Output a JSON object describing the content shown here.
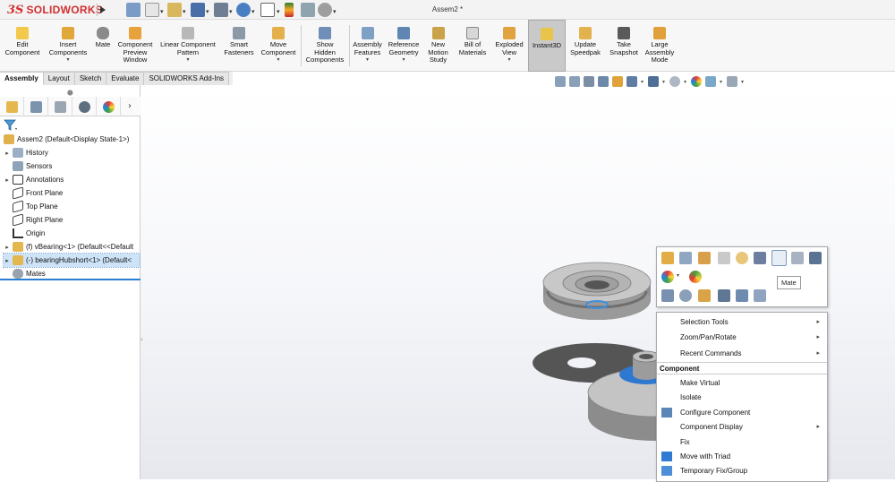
{
  "app": {
    "brand_prefix": "3S",
    "brand": "SOLIDWORKS",
    "document_title": "Assem2 *"
  },
  "colors": {
    "brand_red": "#d32f2f",
    "selection_blue": "#cde3f7",
    "accent_blue": "#2b7fd1"
  },
  "quick_access": [
    {
      "icon": "home-icon"
    },
    {
      "icon": "new-icon"
    },
    {
      "icon": "open-icon"
    },
    {
      "icon": "save-icon"
    },
    {
      "icon": "print-icon"
    },
    {
      "icon": "undo-icon"
    },
    {
      "icon": "select-icon"
    },
    {
      "icon": "rebuild-icon"
    },
    {
      "icon": "file-properties-icon"
    },
    {
      "icon": "options-icon"
    }
  ],
  "ribbon": [
    {
      "label": "Edit\nComponent",
      "dd": ""
    },
    {
      "label": "Insert\nComponents",
      "dd": "▾"
    },
    {
      "label": "Mate",
      "dd": ""
    },
    {
      "label": "Component\nPreview\nWindow",
      "dd": ""
    },
    {
      "label": "Linear Component\nPattern",
      "dd": "▾"
    },
    {
      "label": "Smart\nFasteners",
      "dd": ""
    },
    {
      "label": "Move\nComponent",
      "dd": "▾"
    },
    {
      "label": "Show\nHidden\nComponents",
      "dd": ""
    },
    {
      "label": "Assembly\nFeatures",
      "dd": "▾"
    },
    {
      "label": "Reference\nGeometry",
      "dd": "▾"
    },
    {
      "label": "New\nMotion\nStudy",
      "dd": ""
    },
    {
      "label": "Bill of\nMaterials",
      "dd": ""
    },
    {
      "label": "Exploded\nView",
      "dd": "▾"
    },
    {
      "label": "Instant3D",
      "dd": ""
    },
    {
      "label": "Update\nSpeedpak",
      "dd": ""
    },
    {
      "label": "Take\nSnapshot",
      "dd": ""
    },
    {
      "label": "Large\nAssembly\nMode",
      "dd": ""
    }
  ],
  "tabs": [
    "Assembly",
    "Layout",
    "Sketch",
    "Evaluate",
    "SOLIDWORKS Add-Ins"
  ],
  "feature_tree": [
    {
      "label": "Assem2  (Default<Display State-1>)",
      "exp": ""
    },
    {
      "label": "History",
      "exp": "▸"
    },
    {
      "label": "Sensors",
      "exp": ""
    },
    {
      "label": "Annotations",
      "exp": "▸"
    },
    {
      "label": "Front Plane",
      "exp": ""
    },
    {
      "label": "Top Plane",
      "exp": ""
    },
    {
      "label": "Right Plane",
      "exp": ""
    },
    {
      "label": "Origin",
      "exp": ""
    },
    {
      "label": "(f) vBearing<1> (Default<<Default",
      "exp": "▸"
    },
    {
      "label": "(-) bearingHubshort<1> (Default<",
      "exp": "▸"
    },
    {
      "label": "Mates",
      "exp": ""
    }
  ],
  "context_toolbar": {
    "tooltip": "Mate"
  },
  "context_menu": {
    "items_top": [
      {
        "label": "Selection Tools",
        "arrow": "▸"
      },
      {
        "label": "Zoom/Pan/Rotate",
        "arrow": "▸"
      },
      {
        "label": "Recent Commands",
        "arrow": "▸"
      }
    ],
    "section": "Component",
    "items": [
      {
        "label": "Make Virtual",
        "arrow": ""
      },
      {
        "label": "Isolate",
        "arrow": ""
      },
      {
        "label": "Configure Component",
        "arrow": ""
      },
      {
        "label": "Component Display",
        "arrow": "▸"
      },
      {
        "label": "Fix",
        "arrow": ""
      },
      {
        "label": "Move with Triad",
        "arrow": ""
      },
      {
        "label": "Temporary Fix/Group",
        "arrow": ""
      }
    ]
  }
}
